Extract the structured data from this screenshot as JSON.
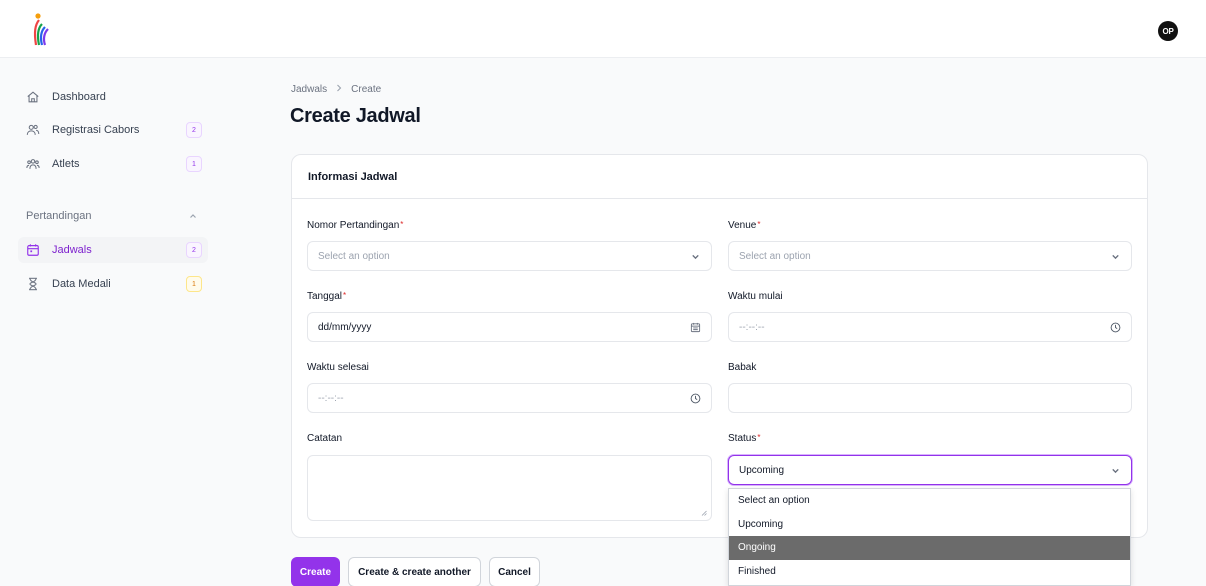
{
  "app": {
    "user_initials": "OP"
  },
  "sidebar": {
    "items": [
      {
        "label": "Dashboard",
        "badge": ""
      },
      {
        "label": "Registrasi Cabors",
        "badge": "2"
      },
      {
        "label": "Atlets",
        "badge": "1"
      }
    ],
    "group": {
      "label": "Pertandingan",
      "items": [
        {
          "label": "Jadwals",
          "badge": "2"
        },
        {
          "label": "Data Medali",
          "badge": "1"
        }
      ]
    }
  },
  "breadcrumb": {
    "parent": "Jadwals",
    "current": "Create"
  },
  "page": {
    "title": "Create Jadwal"
  },
  "form": {
    "section_title": "Informasi Jadwal",
    "required_mark": "*",
    "nomor": {
      "label": "Nomor Pertandingan",
      "placeholder": "Select an option"
    },
    "venue": {
      "label": "Venue",
      "placeholder": "Select an option"
    },
    "tanggal": {
      "label": "Tanggal",
      "value": "dd/mm/yyyy"
    },
    "waktu_mulai": {
      "label": "Waktu mulai",
      "value": "--:--:--"
    },
    "waktu_selesai": {
      "label": "Waktu selesai",
      "value": "--:--:--"
    },
    "babak": {
      "label": "Babak",
      "value": ""
    },
    "catatan": {
      "label": "Catatan",
      "value": ""
    },
    "status": {
      "label": "Status",
      "value": "Upcoming",
      "options": [
        "Select an option",
        "Upcoming",
        "Ongoing",
        "Finished"
      ],
      "highlighted": "Ongoing"
    }
  },
  "actions": {
    "create": "Create",
    "create_another": "Create & create another",
    "cancel": "Cancel"
  },
  "colors": {
    "primary": "#9333ea",
    "active_text": "#7e22ce",
    "required": "#dc2626",
    "dropdown_highlight": "#6b6b6b"
  }
}
